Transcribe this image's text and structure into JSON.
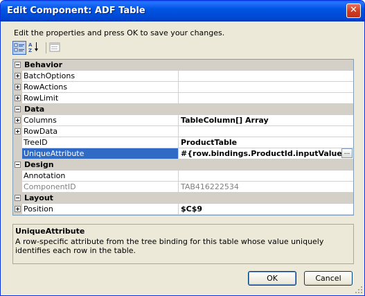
{
  "window": {
    "title": "Edit Component: ADF Table"
  },
  "instructions": "Edit the properties and press OK to save your changes.",
  "toolbar": {
    "categorized_icon": "categorized-icon",
    "alphabetical_icon": "sort-alphabetical-icon",
    "property_pages_icon": "property-pages-icon"
  },
  "grid": {
    "rows": [
      {
        "kind": "category",
        "label": "Behavior"
      },
      {
        "kind": "property",
        "name": "BatchOptions",
        "value": "",
        "expandable": true
      },
      {
        "kind": "property",
        "name": "RowActions",
        "value": "",
        "expandable": true
      },
      {
        "kind": "property",
        "name": "RowLimit",
        "value": "",
        "expandable": true
      },
      {
        "kind": "category",
        "label": "Data"
      },
      {
        "kind": "property",
        "name": "Columns",
        "value": "TableColumn[] Array",
        "expandable": true
      },
      {
        "kind": "property",
        "name": "RowData",
        "value": "",
        "expandable": true
      },
      {
        "kind": "property",
        "name": "TreeID",
        "value": "ProductTable",
        "expandable": false
      },
      {
        "kind": "property",
        "name": "UniqueAttribute",
        "value": "#{row.bindings.ProductId.inputValue}",
        "expandable": false,
        "selected": true
      },
      {
        "kind": "category",
        "label": "Design"
      },
      {
        "kind": "property",
        "name": "Annotation",
        "value": "",
        "expandable": false
      },
      {
        "kind": "property",
        "name": "ComponentID",
        "value": "TAB416222534",
        "expandable": false,
        "disabled": true
      },
      {
        "kind": "category",
        "label": "Layout"
      },
      {
        "kind": "property",
        "name": "Position",
        "value": "$C$9",
        "expandable": true
      }
    ],
    "ellipsis_label": "..."
  },
  "description": {
    "title": "UniqueAttribute",
    "text": "A row-specific attribute from the tree binding for this table whose value uniquely identifies each row in the table."
  },
  "buttons": {
    "ok": "OK",
    "cancel": "Cancel"
  },
  "colors": {
    "title_bar": "#0054e3",
    "selection": "#316ac5",
    "dialog_face": "#ece9d8",
    "close_button": "#cd3d22"
  }
}
